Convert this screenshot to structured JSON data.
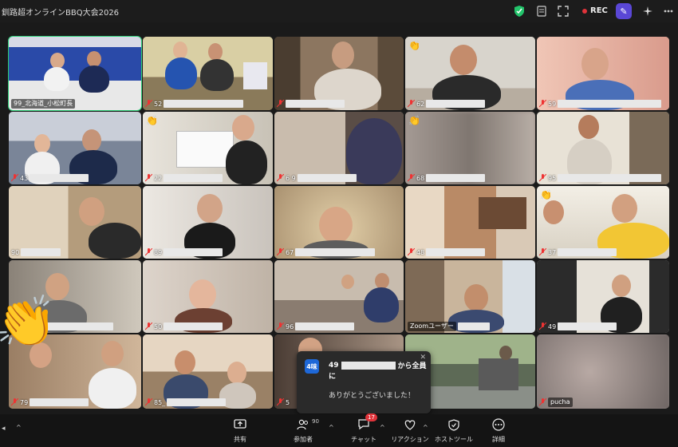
{
  "window": {
    "title": "釧路超オンラインBBQ大会2026",
    "rec_label": "REC"
  },
  "tiles": [
    {
      "id": "t1",
      "num": "99",
      "label": "北海道_小松町長",
      "active": true
    },
    {
      "id": "t2",
      "num": "52"
    },
    {
      "id": "t3",
      "num": ""
    },
    {
      "id": "t4",
      "num": "62"
    },
    {
      "id": "t5",
      "num": "59"
    },
    {
      "id": "t6",
      "num": "43"
    },
    {
      "id": "t7",
      "num": "22"
    },
    {
      "id": "t8",
      "num": "6 9"
    },
    {
      "id": "t9",
      "num": "68"
    },
    {
      "id": "t10",
      "num": "95"
    },
    {
      "id": "t11",
      "num": "90"
    },
    {
      "id": "t12",
      "num": "89"
    },
    {
      "id": "t13",
      "num": "67"
    },
    {
      "id": "t14",
      "num": "48"
    },
    {
      "id": "t15",
      "num": "37"
    },
    {
      "id": "t16",
      "num": ""
    },
    {
      "id": "t17",
      "num": "50"
    },
    {
      "id": "t18",
      "num": "96"
    },
    {
      "id": "t19",
      "num": "",
      "label": "Zoomユーザー"
    },
    {
      "id": "t20",
      "num": "49"
    },
    {
      "id": "t21",
      "num": "79"
    },
    {
      "id": "t22",
      "num": "85_"
    },
    {
      "id": "t23",
      "num": "5"
    },
    {
      "id": "t24",
      "num": ""
    },
    {
      "id": "t25",
      "num": "",
      "label": "pucha"
    }
  ],
  "chat_popup": {
    "avatar_text": "4味",
    "sender_prefix": "49",
    "sender_suffix": "から全員",
    "sender_line2": "に",
    "message": "ありがとうございました！"
  },
  "toolbar": {
    "share_label": "共有",
    "participants_label": "参加者",
    "participants_count": "90",
    "chat_label": "チャット",
    "chat_badge": "17",
    "reaction_label": "リアクション",
    "hosttools_label": "ホストツール",
    "more_label": "詳細"
  },
  "colors": {
    "active_border": "#2fd07a",
    "rec_dot": "#e0333a",
    "chat_avatar": "#1e68d8",
    "badge": "#e0333a"
  }
}
